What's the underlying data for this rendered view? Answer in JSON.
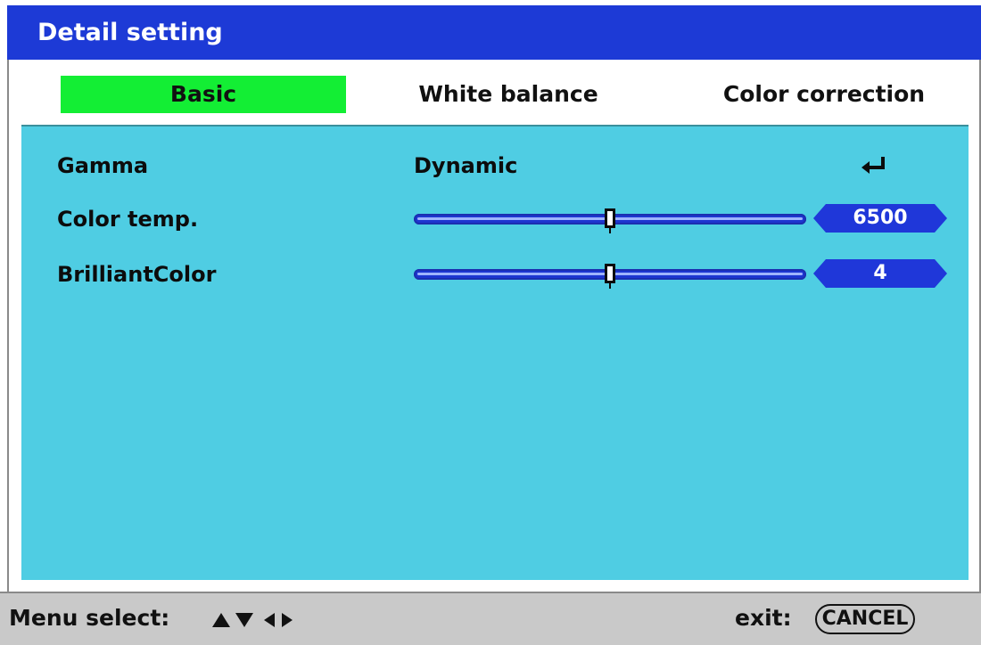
{
  "window": {
    "title": "Detail setting"
  },
  "tabs": [
    {
      "label": "Basic",
      "active": true
    },
    {
      "label": "White balance",
      "active": false
    },
    {
      "label": "Color correction",
      "active": false
    }
  ],
  "settings": {
    "gamma": {
      "label": "Gamma",
      "value": "Dynamic"
    },
    "color_temp": {
      "label": "Color temp.",
      "value": "6500",
      "level": 0.5
    },
    "brilliant_color": {
      "label": "BrilliantColor",
      "value": "4",
      "level": 0.5
    }
  },
  "footer": {
    "menu_select_label": "Menu select:",
    "exit_label": "exit:",
    "cancel_label": "CANCEL"
  },
  "colors": {
    "title_bar": "#1d3ad6",
    "active_tab": "#13ee34",
    "panel": "#4fcde3",
    "value_badge": "#1f37d9",
    "footer": "#c9c9c9"
  },
  "icons": {
    "enter": "enter-icon",
    "nav_arrows": "up-down-left-right-arrows-icon"
  }
}
